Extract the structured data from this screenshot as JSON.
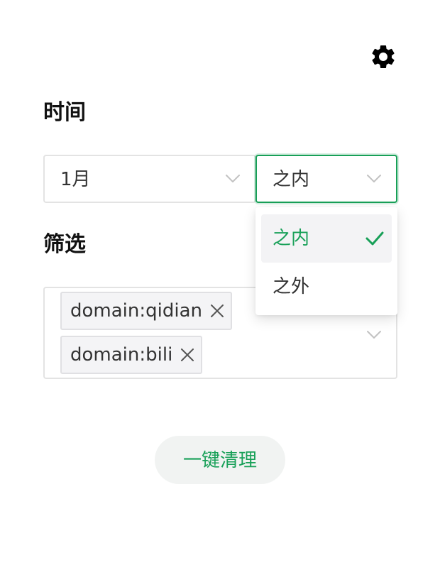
{
  "time_section": {
    "title": "时间",
    "month_select": {
      "value": "1月"
    },
    "range_select": {
      "value": "之内"
    },
    "range_dropdown": {
      "options": [
        {
          "label": "之内",
          "selected": true
        },
        {
          "label": "之外",
          "selected": false
        }
      ]
    }
  },
  "filter_section": {
    "title": "筛选",
    "tags": [
      {
        "label": "domain:qidian"
      },
      {
        "label": "domain:bili"
      }
    ]
  },
  "actions": {
    "clean_label": "一键清理"
  },
  "icons": {
    "settings": "gear-icon",
    "dropdown": "chevron-down-icon",
    "remove": "close-icon",
    "selected": "check-icon"
  },
  "colors": {
    "accent": "#18a058",
    "border": "#e3e3e3",
    "tag_bg": "#f4f4f6",
    "button_bg": "#f1f3f2"
  }
}
